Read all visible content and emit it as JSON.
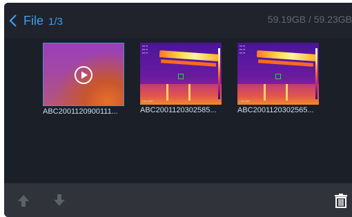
{
  "header": {
    "title": "File",
    "page": "1/3",
    "storage": "59.19GB / 59.23GB"
  },
  "files": [
    {
      "name": "ABC2001120900111...",
      "kind": "video"
    },
    {
      "name": "ABC2001120302585...",
      "kind": "image"
    },
    {
      "name": "ABC2001120302565...",
      "kind": "image"
    }
  ],
  "toolbar": {
    "up_icon": "arrow-up-icon",
    "down_icon": "arrow-down-icon",
    "delete_icon": "trash-icon"
  },
  "colors": {
    "accent": "#3b9ff0",
    "background": "#1b1f27",
    "toolbar": "#30333a",
    "muted_text": "#636874",
    "disabled_icon": "#5c6068"
  }
}
